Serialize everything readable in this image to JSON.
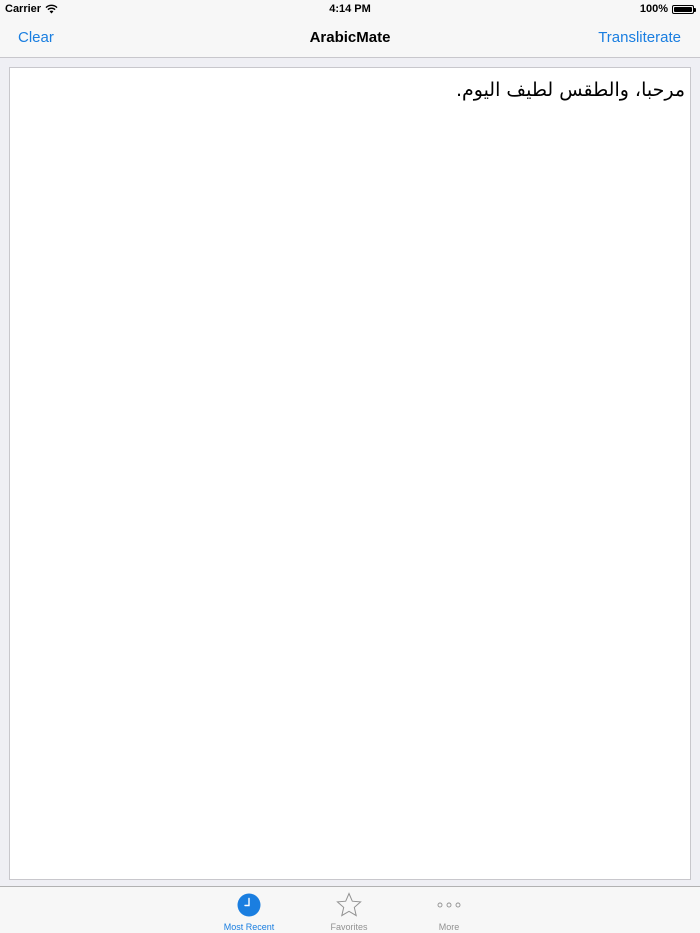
{
  "status_bar": {
    "carrier": "Carrier",
    "time": "4:14 PM",
    "battery": "100%",
    "battery_level": 1.0
  },
  "nav": {
    "left_label": "Clear",
    "title": "ArabicMate",
    "right_label": "Transliterate"
  },
  "editor": {
    "text": "مرحبا، والطقس لطيف اليوم."
  },
  "tabs": [
    {
      "label": "Most Recent",
      "icon": "clock-icon",
      "active": true
    },
    {
      "label": "Favorites",
      "icon": "star-icon",
      "active": false
    },
    {
      "label": "More",
      "icon": "more-dots-icon",
      "active": false
    }
  ],
  "colors": {
    "accent": "#1a7ee0",
    "inactive": "#929292",
    "bar_background": "#f7f7f7",
    "page_background": "#efeff4"
  }
}
